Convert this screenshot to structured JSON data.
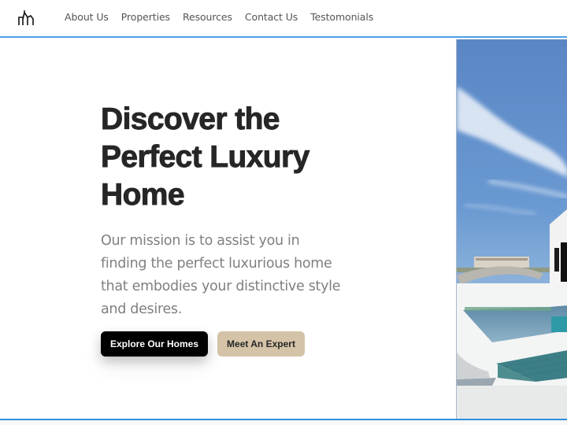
{
  "header": {
    "logo_icon": "house-roofs-logo-icon",
    "nav": [
      {
        "label": "About Us"
      },
      {
        "label": "Properties"
      },
      {
        "label": "Resources"
      },
      {
        "label": "Contact Us"
      },
      {
        "label": "Testomonials"
      }
    ],
    "accent_color": "#4a9fe8"
  },
  "hero": {
    "title_lines": [
      "Discover the",
      "Perfect Luxury",
      "Home"
    ],
    "subtitle_lines": [
      "Our mission is to assist you in",
      "finding the perfect luxurious home",
      "that embodies your distinctive style",
      "and desires."
    ],
    "primary_button": "Explore Our Homes",
    "secondary_button": "Meet An Expert",
    "primary_color": "#000000",
    "secondary_color": "#d4c3a7",
    "image_alt": "Luxury villa with swimming pool under blue sky"
  }
}
